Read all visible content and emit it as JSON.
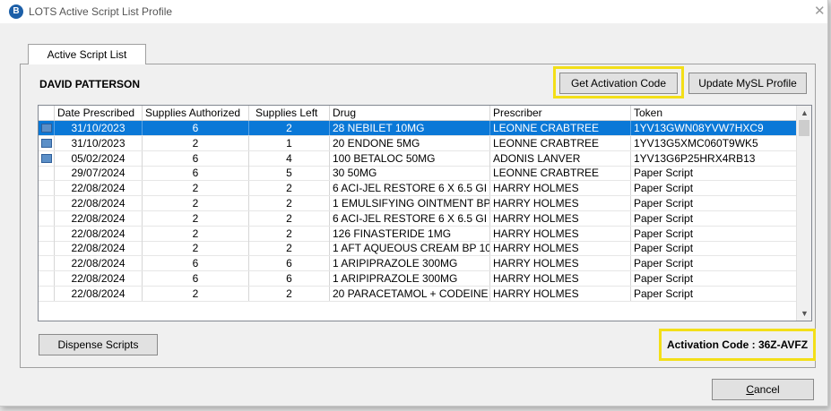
{
  "window": {
    "title": "LOTS Active Script List Profile",
    "close_symbol": "✕"
  },
  "tab": {
    "label": "Active Script List"
  },
  "patient": {
    "name": "DAVID PATTERSON"
  },
  "buttons": {
    "get_activation_code": "Get Activation Code",
    "update_mysl_profile": "Update MySL Profile",
    "dispense_scripts": "Dispense Scripts",
    "cancel_first": "C",
    "cancel_rest": "ancel"
  },
  "activation": {
    "label": "Activation Code : 36Z-AVFZ"
  },
  "table": {
    "columns": [
      "Date Prescribed",
      "Supplies Authorized",
      "Supplies Left",
      "Drug",
      "Prescriber",
      "Token"
    ],
    "rows": [
      {
        "date": "31/10/2023",
        "authorized": "6",
        "left": "2",
        "drug": "28 NEBILET 10MG",
        "prescriber": "LEONNE CRABTREE",
        "token": "1YV13GWN08YVW7HXC9",
        "icon": "script-icon"
      },
      {
        "date": "31/10/2023",
        "authorized": "2",
        "left": "1",
        "drug": "20 ENDONE 5MG",
        "prescriber": "LEONNE CRABTREE",
        "token": "1YV13G5XMC060T9WK5",
        "icon": "script-icon"
      },
      {
        "date": "05/02/2024",
        "authorized": "6",
        "left": "4",
        "drug": "100 BETALOC 50MG",
        "prescriber": "ADONIS LANVER",
        "token": "1YV13G6P25HRX4RB13",
        "icon": "script-icon"
      },
      {
        "date": "29/07/2024",
        "authorized": "6",
        "left": "5",
        "drug": "30  50MG",
        "prescriber": "LEONNE CRABTREE",
        "token": "Paper Script"
      },
      {
        "date": "22/08/2024",
        "authorized": "2",
        "left": "2",
        "drug": "6 ACI-JEL RESTORE 6 X 6.5 GI",
        "prescriber": "HARRY HOLMES",
        "token": "Paper Script"
      },
      {
        "date": "22/08/2024",
        "authorized": "2",
        "left": "2",
        "drug": "1 EMULSIFYING OINTMENT BP",
        "prescriber": "HARRY HOLMES",
        "token": "Paper Script"
      },
      {
        "date": "22/08/2024",
        "authorized": "2",
        "left": "2",
        "drug": "6 ACI-JEL RESTORE 6 X 6.5 GI",
        "prescriber": "HARRY HOLMES",
        "token": "Paper Script"
      },
      {
        "date": "22/08/2024",
        "authorized": "2",
        "left": "2",
        "drug": "126 FINASTERIDE 1MG",
        "prescriber": "HARRY HOLMES",
        "token": "Paper Script"
      },
      {
        "date": "22/08/2024",
        "authorized": "2",
        "left": "2",
        "drug": "1 AFT AQUEOUS CREAM BP 10",
        "prescriber": "HARRY HOLMES",
        "token": "Paper Script"
      },
      {
        "date": "22/08/2024",
        "authorized": "6",
        "left": "6",
        "drug": "1 ARIPIPRAZOLE 300MG",
        "prescriber": "HARRY HOLMES",
        "token": "Paper Script"
      },
      {
        "date": "22/08/2024",
        "authorized": "6",
        "left": "6",
        "drug": "1 ARIPIPRAZOLE 300MG",
        "prescriber": "HARRY HOLMES",
        "token": "Paper Script"
      },
      {
        "date": "22/08/2024",
        "authorized": "2",
        "left": "2",
        "drug": "20 PARACETAMOL + CODEINE",
        "prescriber": "HARRY HOLMES",
        "token": "Paper Script"
      }
    ],
    "selected_row": 0,
    "scroll_up_symbol": "▲",
    "scroll_down_symbol": "▼"
  },
  "colors": {
    "highlight": "#f3df18",
    "selection": "#0a78d7"
  }
}
